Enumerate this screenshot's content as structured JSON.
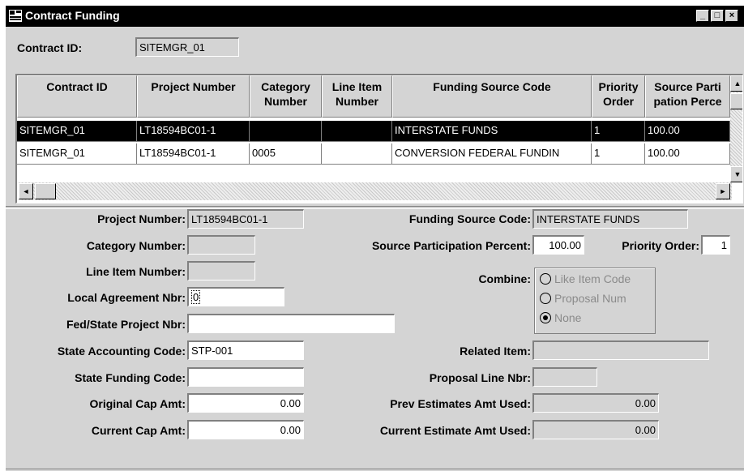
{
  "window": {
    "title": "Contract Funding",
    "controls": {
      "minimize": "_",
      "maximize": "□",
      "close": "×"
    }
  },
  "header": {
    "contract_id_label": "Contract ID:",
    "contract_id_value": "SITEMGR_01"
  },
  "grid": {
    "columns": [
      {
        "label": "Contract ID"
      },
      {
        "label": "Project Number"
      },
      {
        "label": "Category Number"
      },
      {
        "label": "Line Item Number"
      },
      {
        "label": "Funding Source Code"
      },
      {
        "label": "Priority Order"
      },
      {
        "label": "Source Participation Percent"
      }
    ],
    "column_headers_display": [
      "Contract ID",
      "Project Number",
      "Category\nNumber",
      "Line Item\nNumber",
      "Funding Source Code",
      "Priority\nOrder",
      "Source Parti\npation Perce"
    ],
    "rows": [
      {
        "cells": [
          "SITEMGR_01",
          "LT18594BC01-1",
          "",
          "",
          "INTERSTATE FUNDS",
          "1",
          "100.00"
        ],
        "selected": true
      },
      {
        "cells": [
          "SITEMGR_01",
          "LT18594BC01-1",
          "0005",
          "",
          "CONVERSION FEDERAL FUNDIN",
          "1",
          "100.00"
        ],
        "selected": false
      }
    ],
    "scroll_icons": {
      "left": "◄",
      "right": "►",
      "up": "▲",
      "down": "▼"
    }
  },
  "form": {
    "project_number": {
      "label": "Project Number:",
      "value": "LT18594BC01-1"
    },
    "category_number": {
      "label": "Category Number:",
      "value": ""
    },
    "line_item_number": {
      "label": "Line Item Number:",
      "value": ""
    },
    "local_agreement_nbr": {
      "label": "Local Agreement Nbr:",
      "value": "0"
    },
    "fed_state_project_nbr": {
      "label": "Fed/State Project Nbr:",
      "value": ""
    },
    "state_accounting_code": {
      "label": "State Accounting Code:",
      "value": "STP-001"
    },
    "state_funding_code": {
      "label": "State Funding Code:",
      "value": ""
    },
    "original_cap_amt": {
      "label": "Original Cap Amt:",
      "value": "0.00"
    },
    "current_cap_amt": {
      "label": "Current Cap Amt:",
      "value": "0.00"
    },
    "funding_source_code": {
      "label": "Funding Source Code:",
      "value": "INTERSTATE FUNDS"
    },
    "source_participation_percent": {
      "label": "Source Participation Percent:",
      "value": "100.00"
    },
    "priority_order": {
      "label": "Priority Order:",
      "value": "1"
    },
    "combine": {
      "label": "Combine:",
      "options": [
        {
          "label": "Like Item Code",
          "selected": false
        },
        {
          "label": "Proposal Num",
          "selected": false
        },
        {
          "label": "None",
          "selected": true
        }
      ]
    },
    "related_item": {
      "label": "Related Item:",
      "value": ""
    },
    "proposal_line_nbr": {
      "label": "Proposal Line Nbr:",
      "value": ""
    },
    "prev_estimates_amt_used": {
      "label": "Prev Estimates Amt Used:",
      "value": "0.00"
    },
    "current_estimate_amt_used": {
      "label": "Current Estimate Amt Used:",
      "value": "0.00"
    }
  }
}
